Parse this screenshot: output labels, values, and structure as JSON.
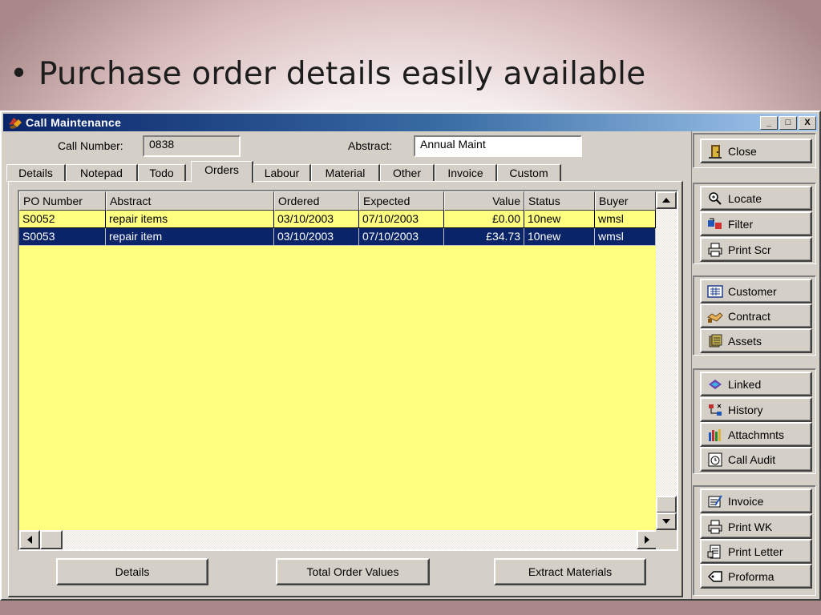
{
  "slide": {
    "bullet": "•",
    "title": "Purchase order details easily available"
  },
  "window": {
    "title": "Call Maintenance",
    "caption_buttons": {
      "minimize": "_",
      "maximize": "□",
      "close": "X"
    }
  },
  "form": {
    "call_number_label": "Call Number:",
    "call_number_value": "0838",
    "abstract_label": "Abstract:",
    "abstract_value": "Annual Maint"
  },
  "tabs": [
    "Details",
    "Notepad",
    "Todo",
    "Orders",
    "Labour",
    "Material",
    "Other",
    "Invoice",
    "Custom"
  ],
  "active_tab": "Orders",
  "grid": {
    "columns": [
      "PO Number",
      "Abstract",
      "Ordered",
      "Expected",
      "Value",
      "Status",
      "Buyer"
    ],
    "rows": [
      {
        "po": "S0052",
        "abstract": "repair items",
        "ordered": "03/10/2003",
        "expected": "07/10/2003",
        "value": "£0.00",
        "status": "10new",
        "buyer": "wmsl",
        "selected": false
      },
      {
        "po": "S0053",
        "abstract": "repair item",
        "ordered": "03/10/2003",
        "expected": "07/10/2003",
        "value": "£34.73",
        "status": "10new",
        "buyer": "wmsl",
        "selected": true
      }
    ]
  },
  "bottom_buttons": {
    "details": "Details",
    "total_order_values": "Total Order Values",
    "extract_materials": "Extract Materials"
  },
  "side_buttons": {
    "close": "Close",
    "locate": "Locate",
    "filter": "Filter",
    "print_scr": "Print Scr",
    "customer": "Customer",
    "contract": "Contract",
    "assets": "Assets",
    "linked": "Linked",
    "history": "History",
    "attachments": "Attachmnts",
    "call_audit": "Call Audit",
    "invoice": "Invoice",
    "print_wk": "Print WK",
    "print_letter": "Print Letter",
    "proforma": "Proforma"
  },
  "colors": {
    "grid_background": "#ffff80",
    "selection": "#0a246a",
    "titlebar": "#0a246a",
    "window": "#d4d0c8"
  }
}
